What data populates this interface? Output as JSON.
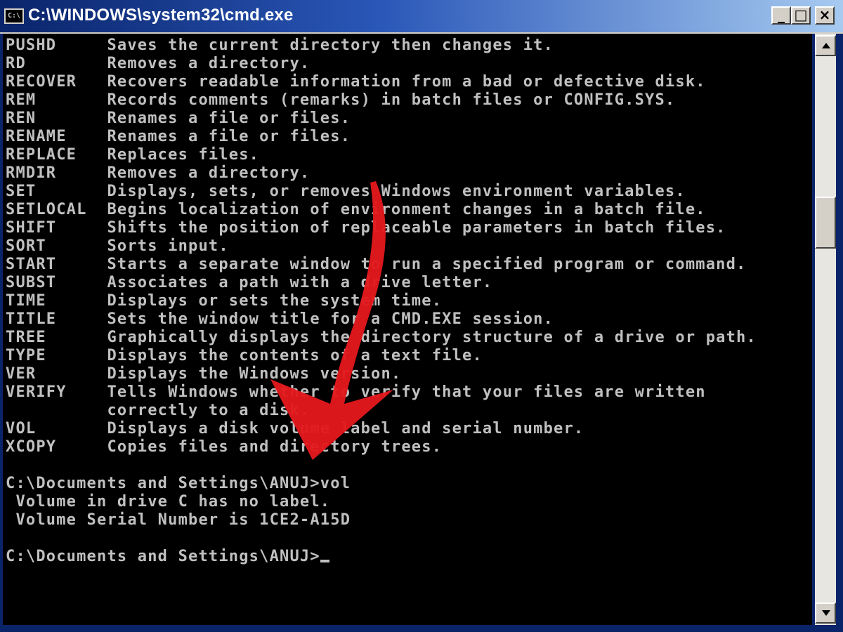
{
  "window": {
    "title": "C:\\WINDOWS\\system32\\cmd.exe",
    "icon_label": "C:\\",
    "controls": {
      "minimize": "_",
      "maximize": "□",
      "close": "×"
    }
  },
  "console": {
    "lines": [
      "PUSHD     Saves the current directory then changes it.",
      "RD        Removes a directory.",
      "RECOVER   Recovers readable information from a bad or defective disk.",
      "REM       Records comments (remarks) in batch files or CONFIG.SYS.",
      "REN       Renames a file or files.",
      "RENAME    Renames a file or files.",
      "REPLACE   Replaces files.",
      "RMDIR     Removes a directory.",
      "SET       Displays, sets, or removes Windows environment variables.",
      "SETLOCAL  Begins localization of environment changes in a batch file.",
      "SHIFT     Shifts the position of replaceable parameters in batch files.",
      "SORT      Sorts input.",
      "START     Starts a separate window to run a specified program or command.",
      "SUBST     Associates a path with a drive letter.",
      "TIME      Displays or sets the system time.",
      "TITLE     Sets the window title for a CMD.EXE session.",
      "TREE      Graphically displays the directory structure of a drive or path.",
      "TYPE      Displays the contents of a text file.",
      "VER       Displays the Windows version.",
      "VERIFY    Tells Windows whether to verify that your files are written",
      "          correctly to a disk.",
      "VOL       Displays a disk volume label and serial number.",
      "XCOPY     Copies files and directory trees.",
      "",
      "C:\\Documents and Settings\\ANUJ>vol",
      " Volume in drive C has no label.",
      " Volume Serial Number is 1CE2-A15D",
      ""
    ],
    "prompt": "C:\\Documents and Settings\\ANUJ>"
  },
  "colors": {
    "console_bg": "#000000",
    "console_text": "#c0c0c0",
    "titlebar_start": "#0a246a",
    "titlebar_end": "#a6caf0",
    "annotation_arrow": "#e3181c"
  },
  "icons": [
    "cmd-app-icon",
    "scroll-up-arrow-icon",
    "scroll-down-arrow-icon",
    "annotation-arrow-icon"
  ]
}
